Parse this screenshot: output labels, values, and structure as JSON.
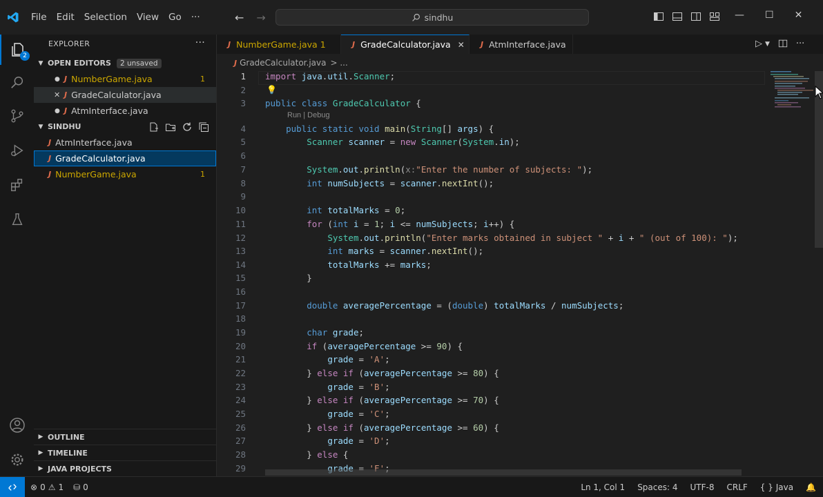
{
  "titlebar": {
    "menu": [
      "File",
      "Edit",
      "Selection",
      "View",
      "Go",
      "···"
    ],
    "search_text": "sindhu",
    "colors": {
      "accent": "#0078d4"
    }
  },
  "activity_bar": {
    "items": [
      "explorer-icon",
      "search-icon",
      "source-control-icon",
      "run-debug-icon",
      "extensions-icon",
      "testing-icon"
    ],
    "explorer_badge": "2",
    "bottom_items": [
      "account-icon",
      "settings-gear-icon"
    ]
  },
  "sidebar": {
    "title": "EXPLORER",
    "more": "···",
    "open_editors": {
      "label": "OPEN EDITORS",
      "badge": "2 unsaved",
      "files": [
        {
          "name": "NumberGame.java",
          "count": "1",
          "marker": "dot"
        },
        {
          "name": "GradeCalculator.java",
          "count": "",
          "marker": "close"
        },
        {
          "name": "AtmInterface.java",
          "count": "",
          "marker": "dot"
        }
      ]
    },
    "folder": {
      "label": "SINDHU",
      "files": [
        {
          "name": "AtmInterface.java",
          "count": ""
        },
        {
          "name": "GradeCalculator.java",
          "count": ""
        },
        {
          "name": "NumberGame.java",
          "count": "1"
        }
      ]
    },
    "bottom_sections": [
      "OUTLINE",
      "TIMELINE",
      "JAVA PROJECTS"
    ]
  },
  "tabs": [
    {
      "name": "NumberGame.java",
      "suffix": "1",
      "state": "modified"
    },
    {
      "name": "GradeCalculator.java",
      "suffix": "",
      "state": "active"
    },
    {
      "name": "AtmInterface.java",
      "suffix": "",
      "state": "modified"
    }
  ],
  "breadcrumb": {
    "file": "GradeCalculator.java",
    "rest": "> ..."
  },
  "editor": {
    "codelens": "Run | Debug",
    "current_line": 1
  },
  "statusbar": {
    "errors": "0",
    "warnings": "1",
    "ports": "0",
    "position": "Ln 1, Col 1",
    "spaces": "Spaces: 4",
    "encoding": "UTF-8",
    "eol": "CRLF",
    "language": "{ } Java"
  }
}
